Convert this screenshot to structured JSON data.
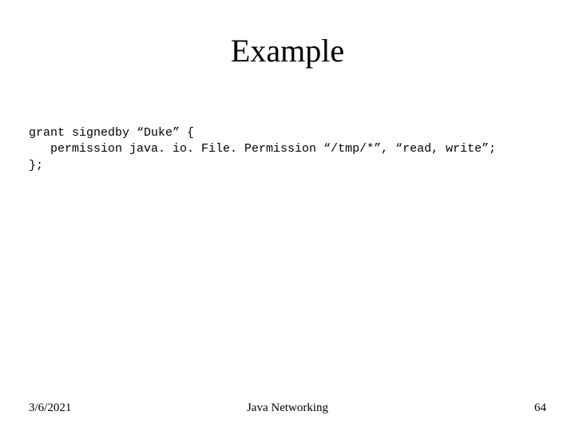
{
  "title": "Example",
  "code": "grant signedby “Duke” {\n   permission java. io. File. Permission “/tmp/*”, “read, write”;\n};",
  "footer": {
    "date": "3/6/2021",
    "topic": "Java Networking",
    "page": "64"
  }
}
